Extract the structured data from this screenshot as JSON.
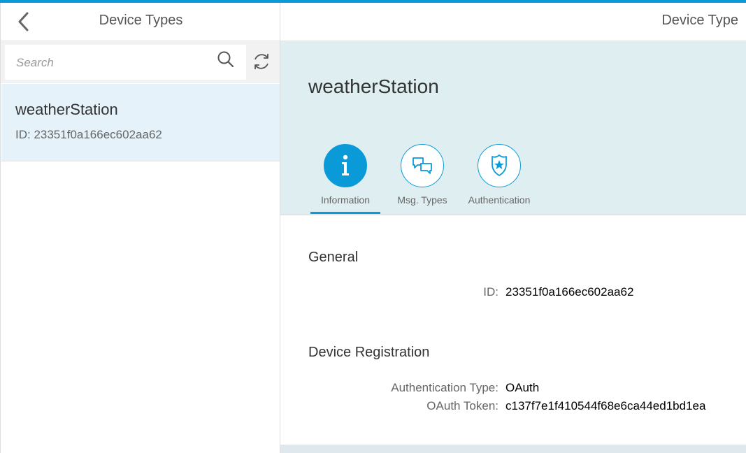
{
  "master": {
    "title": "Device Types",
    "search": {
      "placeholder": "Search"
    },
    "items": [
      {
        "title": "weatherStation",
        "description": "ID: 23351f0a166ec602aa62"
      }
    ]
  },
  "detail": {
    "title": "Device Type",
    "object_title": "weatherStation",
    "tabs": [
      {
        "label": "Information",
        "icon": "info-icon",
        "selected": true
      },
      {
        "label": "Msg. Types",
        "icon": "chat-bubbles-icon",
        "selected": false
      },
      {
        "label": "Authentication",
        "icon": "shield-star-icon",
        "selected": false
      }
    ],
    "sections": {
      "general": {
        "title": "General",
        "fields": [
          {
            "label": "ID:",
            "value": "23351f0a166ec602aa62"
          }
        ]
      },
      "registration": {
        "title": "Device Registration",
        "fields": [
          {
            "label": "Authentication Type:",
            "value": "OAuth"
          },
          {
            "label": "OAuth Token:",
            "value": "c137f7e1f410544f68e6ca44ed1bd1ea"
          }
        ]
      }
    }
  },
  "colors": {
    "accent": "#0a9ad8",
    "selected_item_bg": "#e6f2f9",
    "object_header_bg": "#deeef1"
  }
}
